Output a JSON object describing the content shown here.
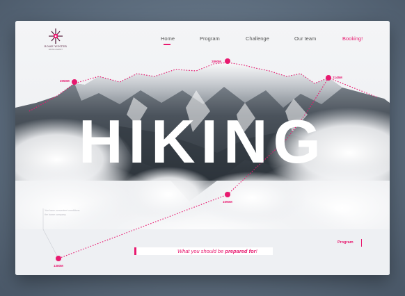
{
  "brand": {
    "name": "ROME WINTER",
    "tagline": "HIKING AGENCY",
    "accent": "#e8196f"
  },
  "nav": {
    "items": [
      {
        "label": "Home",
        "active": true
      },
      {
        "label": "Program",
        "active": false
      },
      {
        "label": "Challenge",
        "active": false
      },
      {
        "label": "Our team",
        "active": false
      },
      {
        "label": "Booking!",
        "active": false,
        "highlight": true
      }
    ]
  },
  "hero": {
    "title": "HIKING"
  },
  "route": {
    "altitudes": [
      "1380M",
      "1590M",
      "2050M",
      "2890M",
      "2145M"
    ]
  },
  "caption": {
    "line1": "You have convenient conditions",
    "line2": "the home company"
  },
  "tagline": {
    "prefix": "What you should be ",
    "emphasis": "prepared for",
    "suffix": "!"
  },
  "footer": {
    "program_link": "Program"
  }
}
